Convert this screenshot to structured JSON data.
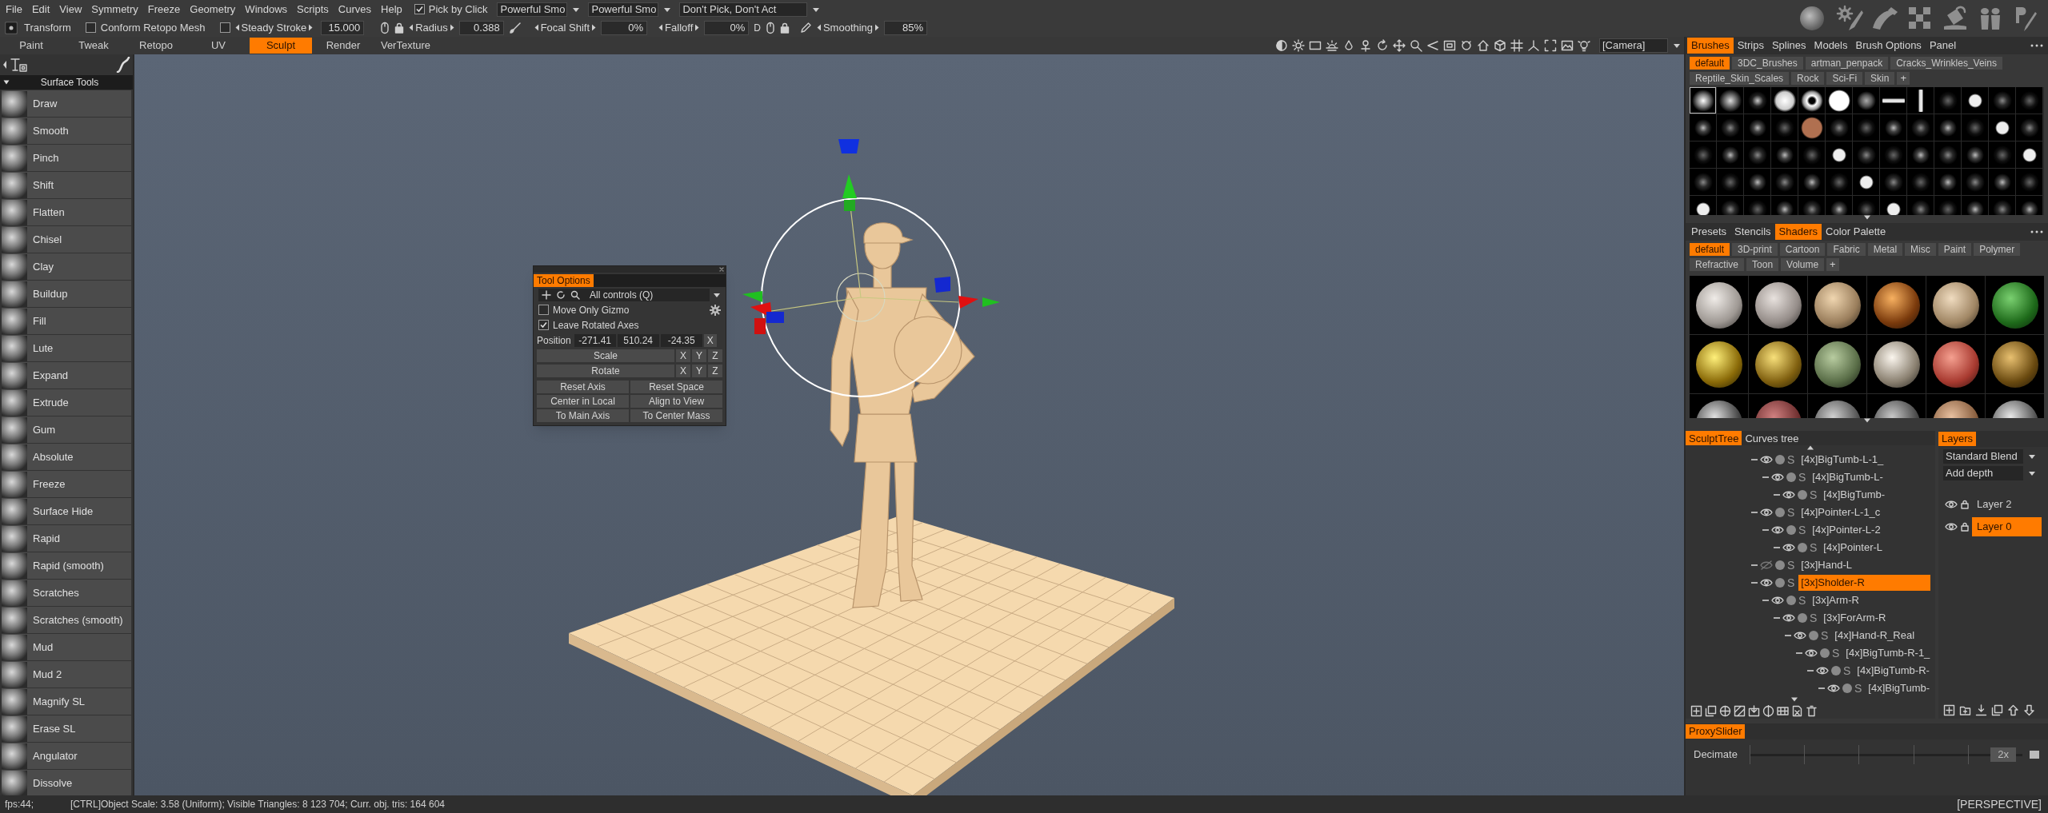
{
  "menu": [
    "File",
    "Edit",
    "View",
    "Symmetry",
    "Freeze",
    "Geometry",
    "Windows",
    "Scripts",
    "Curves",
    "Help"
  ],
  "pick_by_click": {
    "label": "Pick by Click",
    "checked": true
  },
  "pick_dropdowns": [
    "Powerful Smo",
    "Powerful Smo",
    "Don't Pick, Don't Act"
  ],
  "toolbar": {
    "transform": "Transform",
    "conform": {
      "label": "Conform Retopo Mesh",
      "checked": false
    },
    "steady_stroke": {
      "label": "Steady Stroke",
      "checked": false,
      "value": "15.000"
    },
    "radius": {
      "label": "Radius",
      "value": "0.388"
    },
    "focal_shift": {
      "label": "Focal Shift",
      "value": "0%"
    },
    "falloff": {
      "label": "Falloff",
      "value": "0%"
    },
    "depth_key": "D",
    "smoothing": {
      "label": "Smoothing",
      "value": "85%"
    }
  },
  "rooms": [
    {
      "label": "Paint",
      "selected": false
    },
    {
      "label": "Tweak",
      "selected": false
    },
    {
      "label": "Retopo",
      "selected": false
    },
    {
      "label": "UV",
      "selected": false
    },
    {
      "label": "Sculpt",
      "selected": true
    },
    {
      "label": "Render",
      "selected": false
    },
    {
      "label": "VerTexture",
      "selected": false
    }
  ],
  "camera": "[Camera]",
  "tool_panel": {
    "section": "Surface Tools",
    "tools": [
      "Draw",
      "Smooth",
      "Pinch",
      "Shift",
      "Flatten",
      "Chisel",
      "Clay",
      "Buildup",
      "Fill",
      "Lute",
      "Expand",
      "Extrude",
      "Gum",
      "Absolute",
      "Freeze",
      "Surface Hide",
      "Rapid",
      "Rapid (smooth)",
      "Scratches",
      "Scratches (smooth)",
      "Mud",
      "Mud 2",
      "Magnify SL",
      "Erase SL",
      "Angulator",
      "Dissolve"
    ]
  },
  "tool_options": {
    "title": "Tool Options",
    "mode": "All controls (Q)",
    "checks": [
      {
        "label": "Move Only Gizmo",
        "checked": false
      },
      {
        "label": "Leave Rotated Axes",
        "checked": true
      }
    ],
    "position": {
      "label": "Position",
      "values": [
        "-271.41",
        "510.24",
        "-24.35"
      ],
      "axis": "X"
    },
    "transforms": [
      {
        "label": "Scale",
        "axes": [
          "X",
          "Y",
          "Z"
        ]
      },
      {
        "label": "Rotate",
        "axes": [
          "X",
          "Y",
          "Z"
        ]
      }
    ],
    "buttons": [
      "Reset Axis",
      "Reset Space",
      "Center in Local",
      "Align to View",
      "To Main Axis",
      "To Center Mass"
    ]
  },
  "brush_panel": {
    "tabs": [
      {
        "label": "Brushes",
        "selected": true
      },
      {
        "label": "Strips",
        "selected": false
      },
      {
        "label": "Splines",
        "selected": false
      },
      {
        "label": "Models",
        "selected": false
      },
      {
        "label": "Brush Options",
        "selected": false
      },
      {
        "label": "Panel",
        "selected": false
      }
    ],
    "categories": [
      {
        "label": "default",
        "selected": true
      },
      {
        "label": "3DC_Brushes",
        "selected": false
      },
      {
        "label": "artman_penpack",
        "selected": false
      },
      {
        "label": "Cracks_Wrinkles_Veins",
        "selected": false
      },
      {
        "label": "Reptile_Skin_Scales",
        "selected": false
      },
      {
        "label": "Rock",
        "selected": false
      },
      {
        "label": "Sci-Fi",
        "selected": false
      },
      {
        "label": "Skin",
        "selected": false
      }
    ],
    "add": "+"
  },
  "shader_panel": {
    "tabs": [
      {
        "label": "Presets",
        "selected": false
      },
      {
        "label": "Stencils",
        "selected": false
      },
      {
        "label": "Shaders",
        "selected": true
      },
      {
        "label": "Color Palette",
        "selected": false
      }
    ],
    "categories": [
      {
        "label": "default",
        "selected": true
      },
      {
        "label": "3D-print",
        "selected": false
      },
      {
        "label": "Cartoon",
        "selected": false
      },
      {
        "label": "Fabric",
        "selected": false
      },
      {
        "label": "Metal",
        "selected": false
      },
      {
        "label": "Misc",
        "selected": false
      },
      {
        "label": "Paint",
        "selected": false
      },
      {
        "label": "Polymer",
        "selected": false
      },
      {
        "label": "Refractive",
        "selected": false
      },
      {
        "label": "Toon",
        "selected": false
      },
      {
        "label": "Volume",
        "selected": false
      }
    ],
    "add": "+"
  },
  "sculpt_tree": {
    "tabs": [
      {
        "label": "SculptTree",
        "selected": true
      },
      {
        "label": "Curves tree",
        "selected": false
      }
    ],
    "items": [
      {
        "label": "[4x]BigTumb-L-1_",
        "tag": "S",
        "visible": true,
        "selected": false,
        "children": [
          {
            "label": "[4x]BigTumb-L-",
            "tag": "S",
            "visible": true,
            "selected": false,
            "children": [
              {
                "label": "[4x]BigTumb-",
                "tag": "S",
                "visible": true,
                "selected": false
              }
            ]
          }
        ]
      },
      {
        "label": "[4x]Pointer-L-1_c",
        "tag": "S",
        "visible": true,
        "selected": false,
        "children": [
          {
            "label": "[4x]Pointer-L-2",
            "tag": "S",
            "visible": true,
            "selected": false,
            "children": [
              {
                "label": "[4x]Pointer-L",
                "tag": "S",
                "visible": true,
                "selected": false
              }
            ]
          }
        ]
      },
      {
        "label": "[3x]Hand-L",
        "tag": "S",
        "visible": false,
        "selected": false
      },
      {
        "label": "[3x]Sholder-R",
        "tag": "S",
        "visible": true,
        "selected": true,
        "children": [
          {
            "label": "[3x]Arm-R",
            "tag": "S",
            "visible": true,
            "selected": false,
            "children": [
              {
                "label": "[3x]ForArm-R",
                "tag": "S",
                "visible": true,
                "selected": false,
                "children": [
                  {
                    "label": "[4x]Hand-R_Real",
                    "tag": "S",
                    "visible": true,
                    "selected": false,
                    "children": [
                      {
                        "label": "[4x]BigTumb-R-1_",
                        "tag": "S",
                        "visible": true,
                        "selected": false,
                        "children": [
                          {
                            "label": "[4x]BigTumb-R-",
                            "tag": "S",
                            "visible": true,
                            "selected": false,
                            "children": [
                              {
                                "label": "[4x]BigTumb-",
                                "tag": "S",
                                "visible": true,
                                "selected": false
                              }
                            ]
                          }
                        ]
                      }
                    ]
                  }
                ]
              }
            ]
          }
        ]
      }
    ]
  },
  "layers": {
    "tab": "Layers",
    "blend": "Standard Blend",
    "mode": "Add depth",
    "items": [
      {
        "label": "Layer 2",
        "selected": false
      },
      {
        "label": "Layer 0",
        "selected": true
      }
    ]
  },
  "proxy": {
    "tab": "ProxySlider",
    "label": "Decimate",
    "level": 0.93,
    "value": "2x"
  },
  "status": {
    "fps": "fps:44;",
    "info": "[CTRL]Object Scale: 3.58 (Uniform); Visible Triangles: 8 123 704; Curr. obj. tris: 164 604",
    "view": "[PERSPECTIVE]"
  }
}
